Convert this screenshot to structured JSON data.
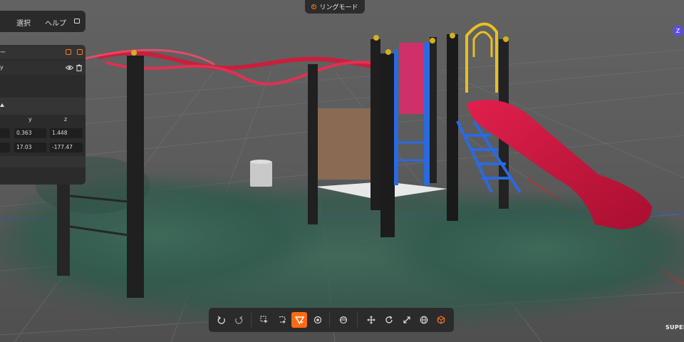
{
  "menu": {
    "select_label": "選択",
    "help_label": "ヘルプ"
  },
  "mode": {
    "label": "リングモード"
  },
  "gizmo": {
    "axis_label": "Z"
  },
  "panel": {
    "title_fragment": "ー",
    "item_fragment": "y",
    "headers": {
      "y": "y",
      "z": "z"
    },
    "position": {
      "y": "0.363",
      "z": "1.448"
    },
    "rotation": {
      "y": "17.03",
      "z": "-177.47"
    }
  },
  "toolbar": {
    "icons": [
      "undo-icon",
      "redo-icon",
      "select-cursor-icon",
      "lasso-select-icon",
      "brush-select-icon",
      "sphere-select-icon",
      "crop-icon",
      "move-icon",
      "rotate-icon",
      "scale-icon",
      "globe-icon",
      "box-icon"
    ],
    "active_tool": "brush-select-icon"
  },
  "brand": {
    "label": "SUPER"
  },
  "colors": {
    "accent": "#ff6a13",
    "gizmo": "#5b4fe0",
    "slide": "#c8143c"
  }
}
